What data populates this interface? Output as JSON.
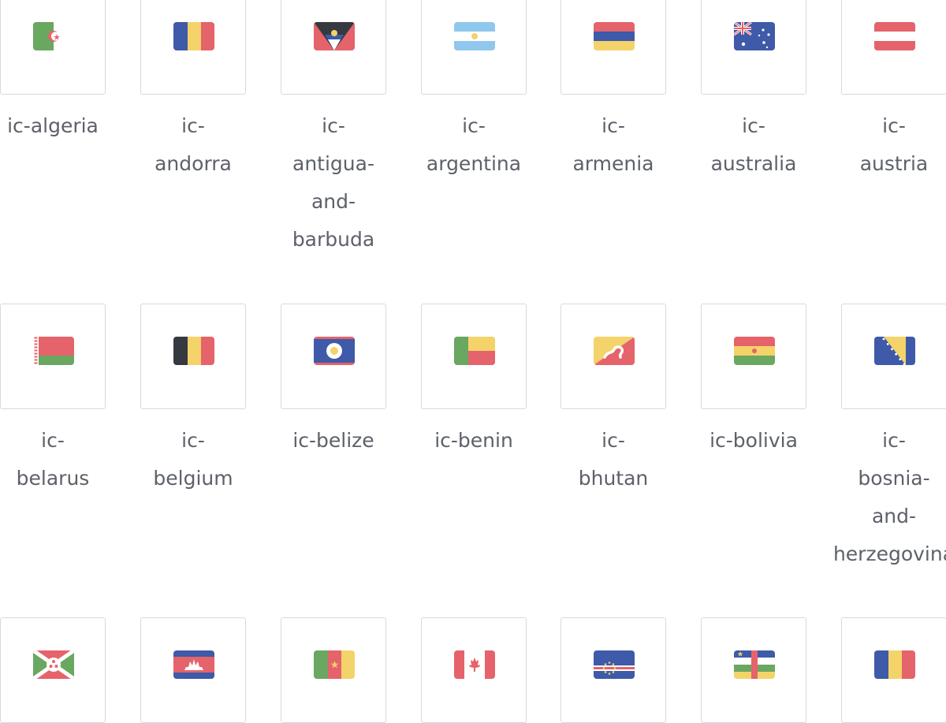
{
  "colors": {
    "red": "#e5636a",
    "yellow": "#f3d36a",
    "blue": "#3e5aa8",
    "green": "#6aa760",
    "light_blue": "#8fc8ec",
    "black": "#363a40",
    "white": "#ffffff",
    "border": "#d6d9de",
    "text": "#5d6169"
  },
  "icons": [
    {
      "label": "ic-algeria",
      "label_lines": [
        "ic-algeria"
      ],
      "flag": "algeria"
    },
    {
      "label": "ic-andorra",
      "label_lines": [
        "ic-",
        "andorra"
      ],
      "flag": "andorra"
    },
    {
      "label": "ic-antigua-and-barbuda",
      "label_lines": [
        "ic-",
        "antigua-",
        "and-",
        "barbuda"
      ],
      "flag": "antigua-and-barbuda"
    },
    {
      "label": "ic-argentina",
      "label_lines": [
        "ic-",
        "argentina"
      ],
      "flag": "argentina"
    },
    {
      "label": "ic-armenia",
      "label_lines": [
        "ic-",
        "armenia"
      ],
      "flag": "armenia"
    },
    {
      "label": "ic-australia",
      "label_lines": [
        "ic-",
        "australia"
      ],
      "flag": "australia"
    },
    {
      "label": "ic-austria",
      "label_lines": [
        "ic-",
        "austria"
      ],
      "flag": "austria"
    },
    {
      "label": "ic-belarus",
      "label_lines": [
        "ic-",
        "belarus"
      ],
      "flag": "belarus"
    },
    {
      "label": "ic-belgium",
      "label_lines": [
        "ic-",
        "belgium"
      ],
      "flag": "belgium"
    },
    {
      "label": "ic-belize",
      "label_lines": [
        "ic-belize"
      ],
      "flag": "belize"
    },
    {
      "label": "ic-benin",
      "label_lines": [
        "ic-benin"
      ],
      "flag": "benin"
    },
    {
      "label": "ic-bhutan",
      "label_lines": [
        "ic-",
        "bhutan"
      ],
      "flag": "bhutan"
    },
    {
      "label": "ic-bolivia",
      "label_lines": [
        "ic-bolivia"
      ],
      "flag": "bolivia"
    },
    {
      "label": "ic-bosnia-and-herzegovina",
      "label_lines": [
        "ic-",
        "bosnia-",
        "and-",
        "herzegovina"
      ],
      "flag": "bosnia-and-herzegovina"
    },
    {
      "label": "",
      "label_lines": [],
      "flag": "burundi"
    },
    {
      "label": "",
      "label_lines": [],
      "flag": "cambodia"
    },
    {
      "label": "",
      "label_lines": [],
      "flag": "cameroon"
    },
    {
      "label": "",
      "label_lines": [],
      "flag": "canada"
    },
    {
      "label": "",
      "label_lines": [],
      "flag": "cape-verde"
    },
    {
      "label": "",
      "label_lines": [],
      "flag": "central-african-republic"
    },
    {
      "label": "",
      "label_lines": [],
      "flag": "chad"
    }
  ]
}
